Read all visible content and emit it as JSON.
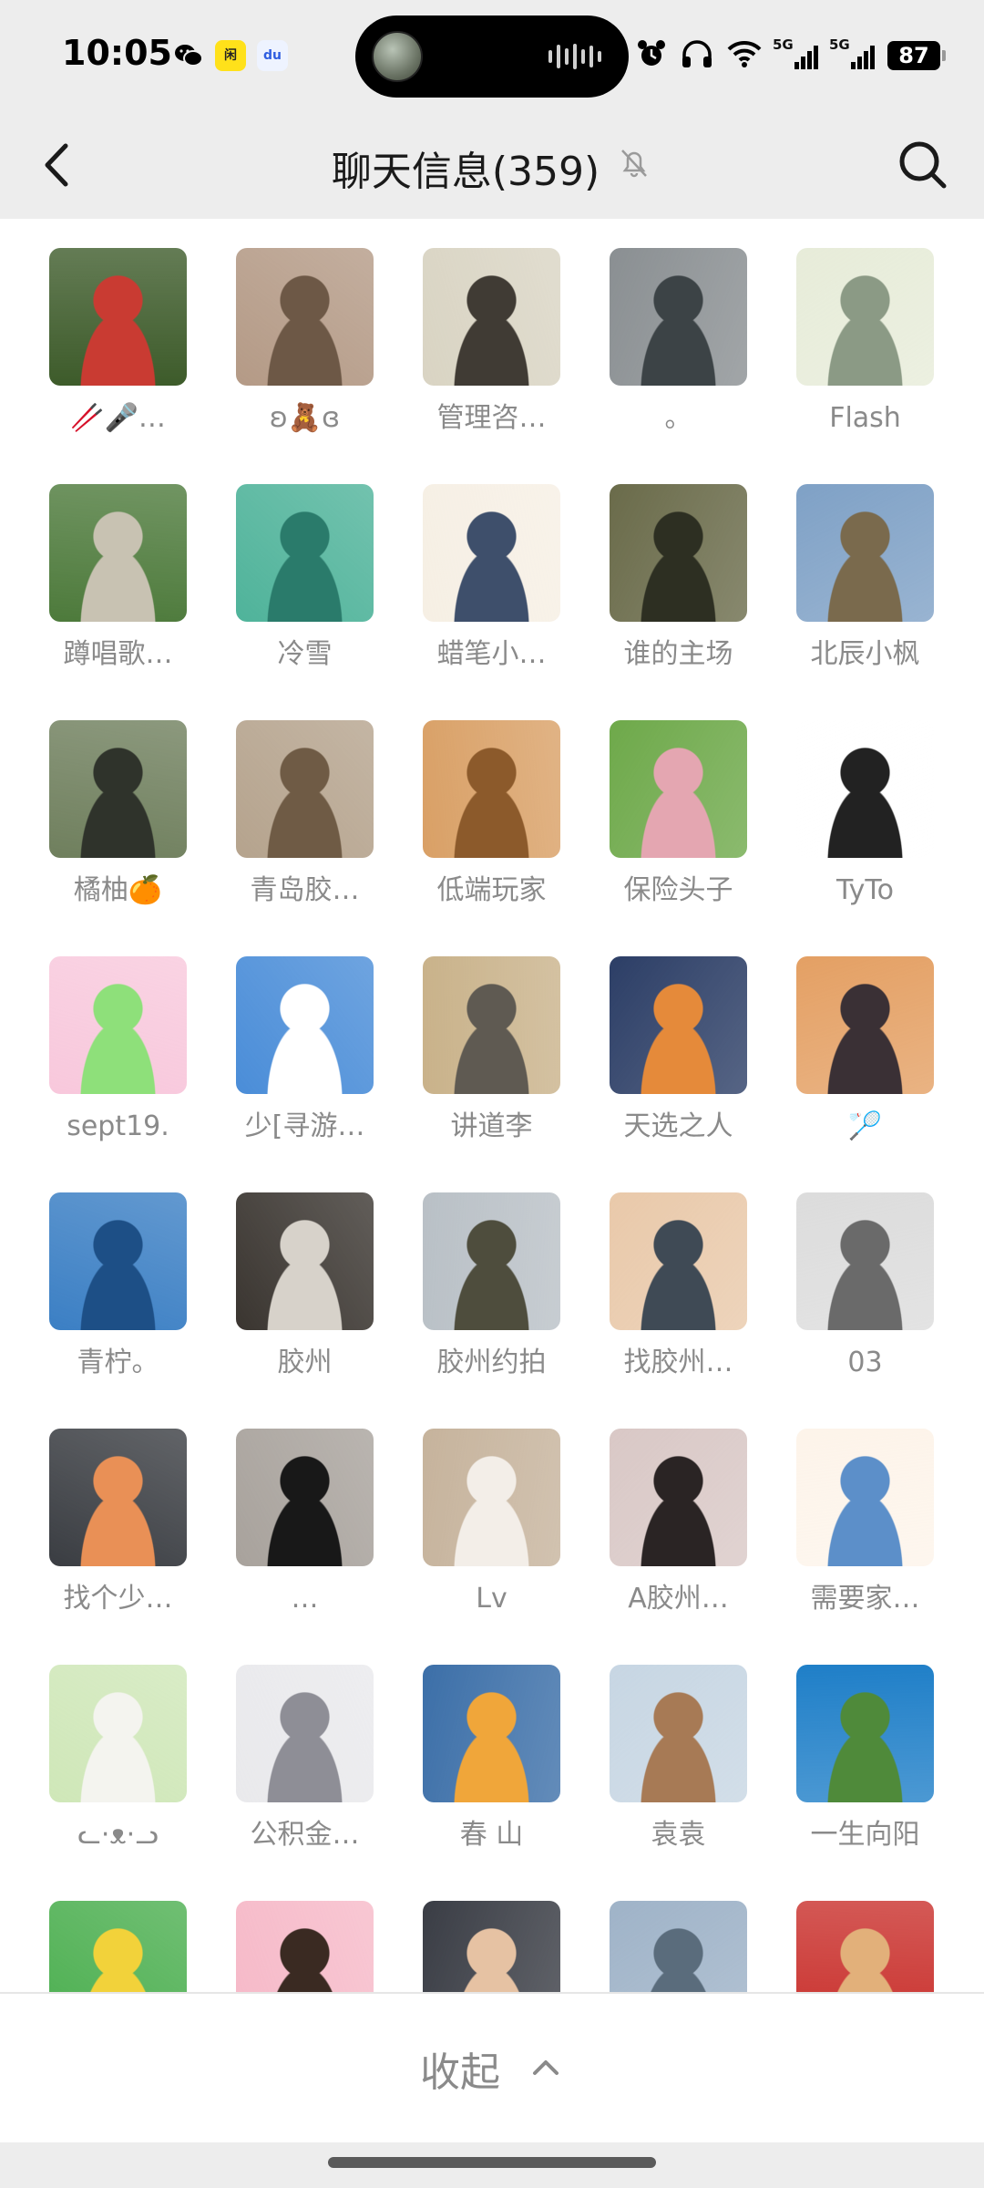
{
  "status_bar": {
    "time": "10:05",
    "app_icons": [
      "wechat-icon",
      "shopping-app-icon",
      "baidu-icon"
    ],
    "app_icon_labels": [
      "微",
      "闲",
      "du"
    ],
    "right_icons": [
      "alarm-icon",
      "headphones-icon",
      "wifi-icon"
    ],
    "network_1": "5G",
    "network_2": "5G",
    "battery": "87"
  },
  "header": {
    "title": "聊天信息(359)",
    "mute_icon": "bell-off-icon",
    "back_icon": "chevron-left-icon",
    "search_icon": "search-icon"
  },
  "members": [
    {
      "name": "🥢🎤…",
      "colors": [
        "#3d5b2a",
        "#c93b32"
      ]
    },
    {
      "name": "ʚ🧸ɞ",
      "colors": [
        "#b49a86",
        "#6d5846"
      ]
    },
    {
      "name": "管理咨…",
      "colors": [
        "#d9d4c3",
        "#403b34"
      ]
    },
    {
      "name": "。",
      "colors": [
        "#8a8f92",
        "#3c4346"
      ]
    },
    {
      "name": "Flash",
      "colors": [
        "#e7ecd9",
        "#8b9a85"
      ]
    },
    {
      "name": "蹲唱歌…",
      "colors": [
        "#4d7a3b",
        "#c8c2b2"
      ]
    },
    {
      "name": "冷雪",
      "colors": [
        "#4fb39a",
        "#2a7b6b"
      ]
    },
    {
      "name": "蜡笔小…",
      "colors": [
        "#f6efe4",
        "#3e4f6b"
      ]
    },
    {
      "name": "谁的主场",
      "colors": [
        "#6a6b4a",
        "#2d2f22"
      ]
    },
    {
      "name": "北辰小枫",
      "colors": [
        "#7fa1c6",
        "#7a6a4d"
      ]
    },
    {
      "name": "橘柚🍊",
      "colors": [
        "#6f7f5d",
        "#2f332b"
      ]
    },
    {
      "name": "青岛胶…",
      "colors": [
        "#b5a38d",
        "#6f5b45"
      ]
    },
    {
      "name": "低端玩家",
      "colors": [
        "#d9a066",
        "#8c5a2b"
      ]
    },
    {
      "name": "保险头子",
      "colors": [
        "#6ea94a",
        "#e4a6b1"
      ]
    },
    {
      "name": "TyTo",
      "colors": [
        "#ffffff",
        "#222222"
      ]
    },
    {
      "name": "sept19.",
      "colors": [
        "#f8c8dc",
        "#8ee07a"
      ]
    },
    {
      "name": "少[寻游…",
      "colors": [
        "#4a8dd8",
        "#ffffff"
      ]
    },
    {
      "name": "讲道李",
      "colors": [
        "#c9b28a",
        "#5f5a52"
      ]
    },
    {
      "name": "天选之人",
      "colors": [
        "#2c3e66",
        "#e58a3a"
      ]
    },
    {
      "name": "🏸",
      "colors": [
        "#e4a064",
        "#3a3035"
      ]
    },
    {
      "name": "青柠。",
      "colors": [
        "#3b7fc4",
        "#1d4f86"
      ]
    },
    {
      "name": "胶州",
      "colors": [
        "#3a3530",
        "#d7d2ca"
      ]
    },
    {
      "name": "胶州约拍",
      "colors": [
        "#b9c0c6",
        "#4e4d3d"
      ]
    },
    {
      "name": "找胶州…",
      "colors": [
        "#e9c9aa",
        "#3f4a55"
      ]
    },
    {
      "name": "03",
      "colors": [
        "#dcdcdc",
        "#6a6a6a"
      ]
    },
    {
      "name": "找个少…",
      "colors": [
        "#3a3d42",
        "#e99056"
      ]
    },
    {
      "name": "…",
      "colors": [
        "#a8a29c",
        "#181818"
      ]
    },
    {
      "name": "Lv",
      "colors": [
        "#c6b39c",
        "#f3eee8"
      ]
    },
    {
      "name": "A胶州…",
      "colors": [
        "#d9c8c6",
        "#2a2424"
      ]
    },
    {
      "name": "需要家…",
      "colors": [
        "#fdf4ea",
        "#5c8fc9"
      ]
    },
    {
      "name": "ᓚ·ᴥ·ᓗ",
      "colors": [
        "#cfe7b8",
        "#f4f4ef"
      ]
    },
    {
      "name": "公积金…",
      "colors": [
        "#e9e9ec",
        "#8e8e96"
      ]
    },
    {
      "name": "春 山",
      "colors": [
        "#3c6fa8",
        "#f0a63a"
      ]
    },
    {
      "name": "袁袁",
      "colors": [
        "#c7d6e3",
        "#a77a55"
      ]
    },
    {
      "name": "一生向阳",
      "colors": [
        "#1f7fc8",
        "#4f8a3a"
      ]
    },
    {
      "name": "",
      "colors": [
        "#4caf50",
        "#f2d23a"
      ]
    },
    {
      "name": "",
      "colors": [
        "#f6b9c8",
        "#3a2a22"
      ]
    },
    {
      "name": "",
      "colors": [
        "#3a3d45",
        "#e6c2a3"
      ]
    },
    {
      "name": "",
      "colors": [
        "#9fb3c8",
        "#5a6c7c"
      ]
    },
    {
      "name": "",
      "colors": [
        "#c9302c",
        "#e2b07a"
      ]
    }
  ],
  "footer": {
    "collapse_label": "收起",
    "collapse_icon": "chevron-up-icon"
  }
}
